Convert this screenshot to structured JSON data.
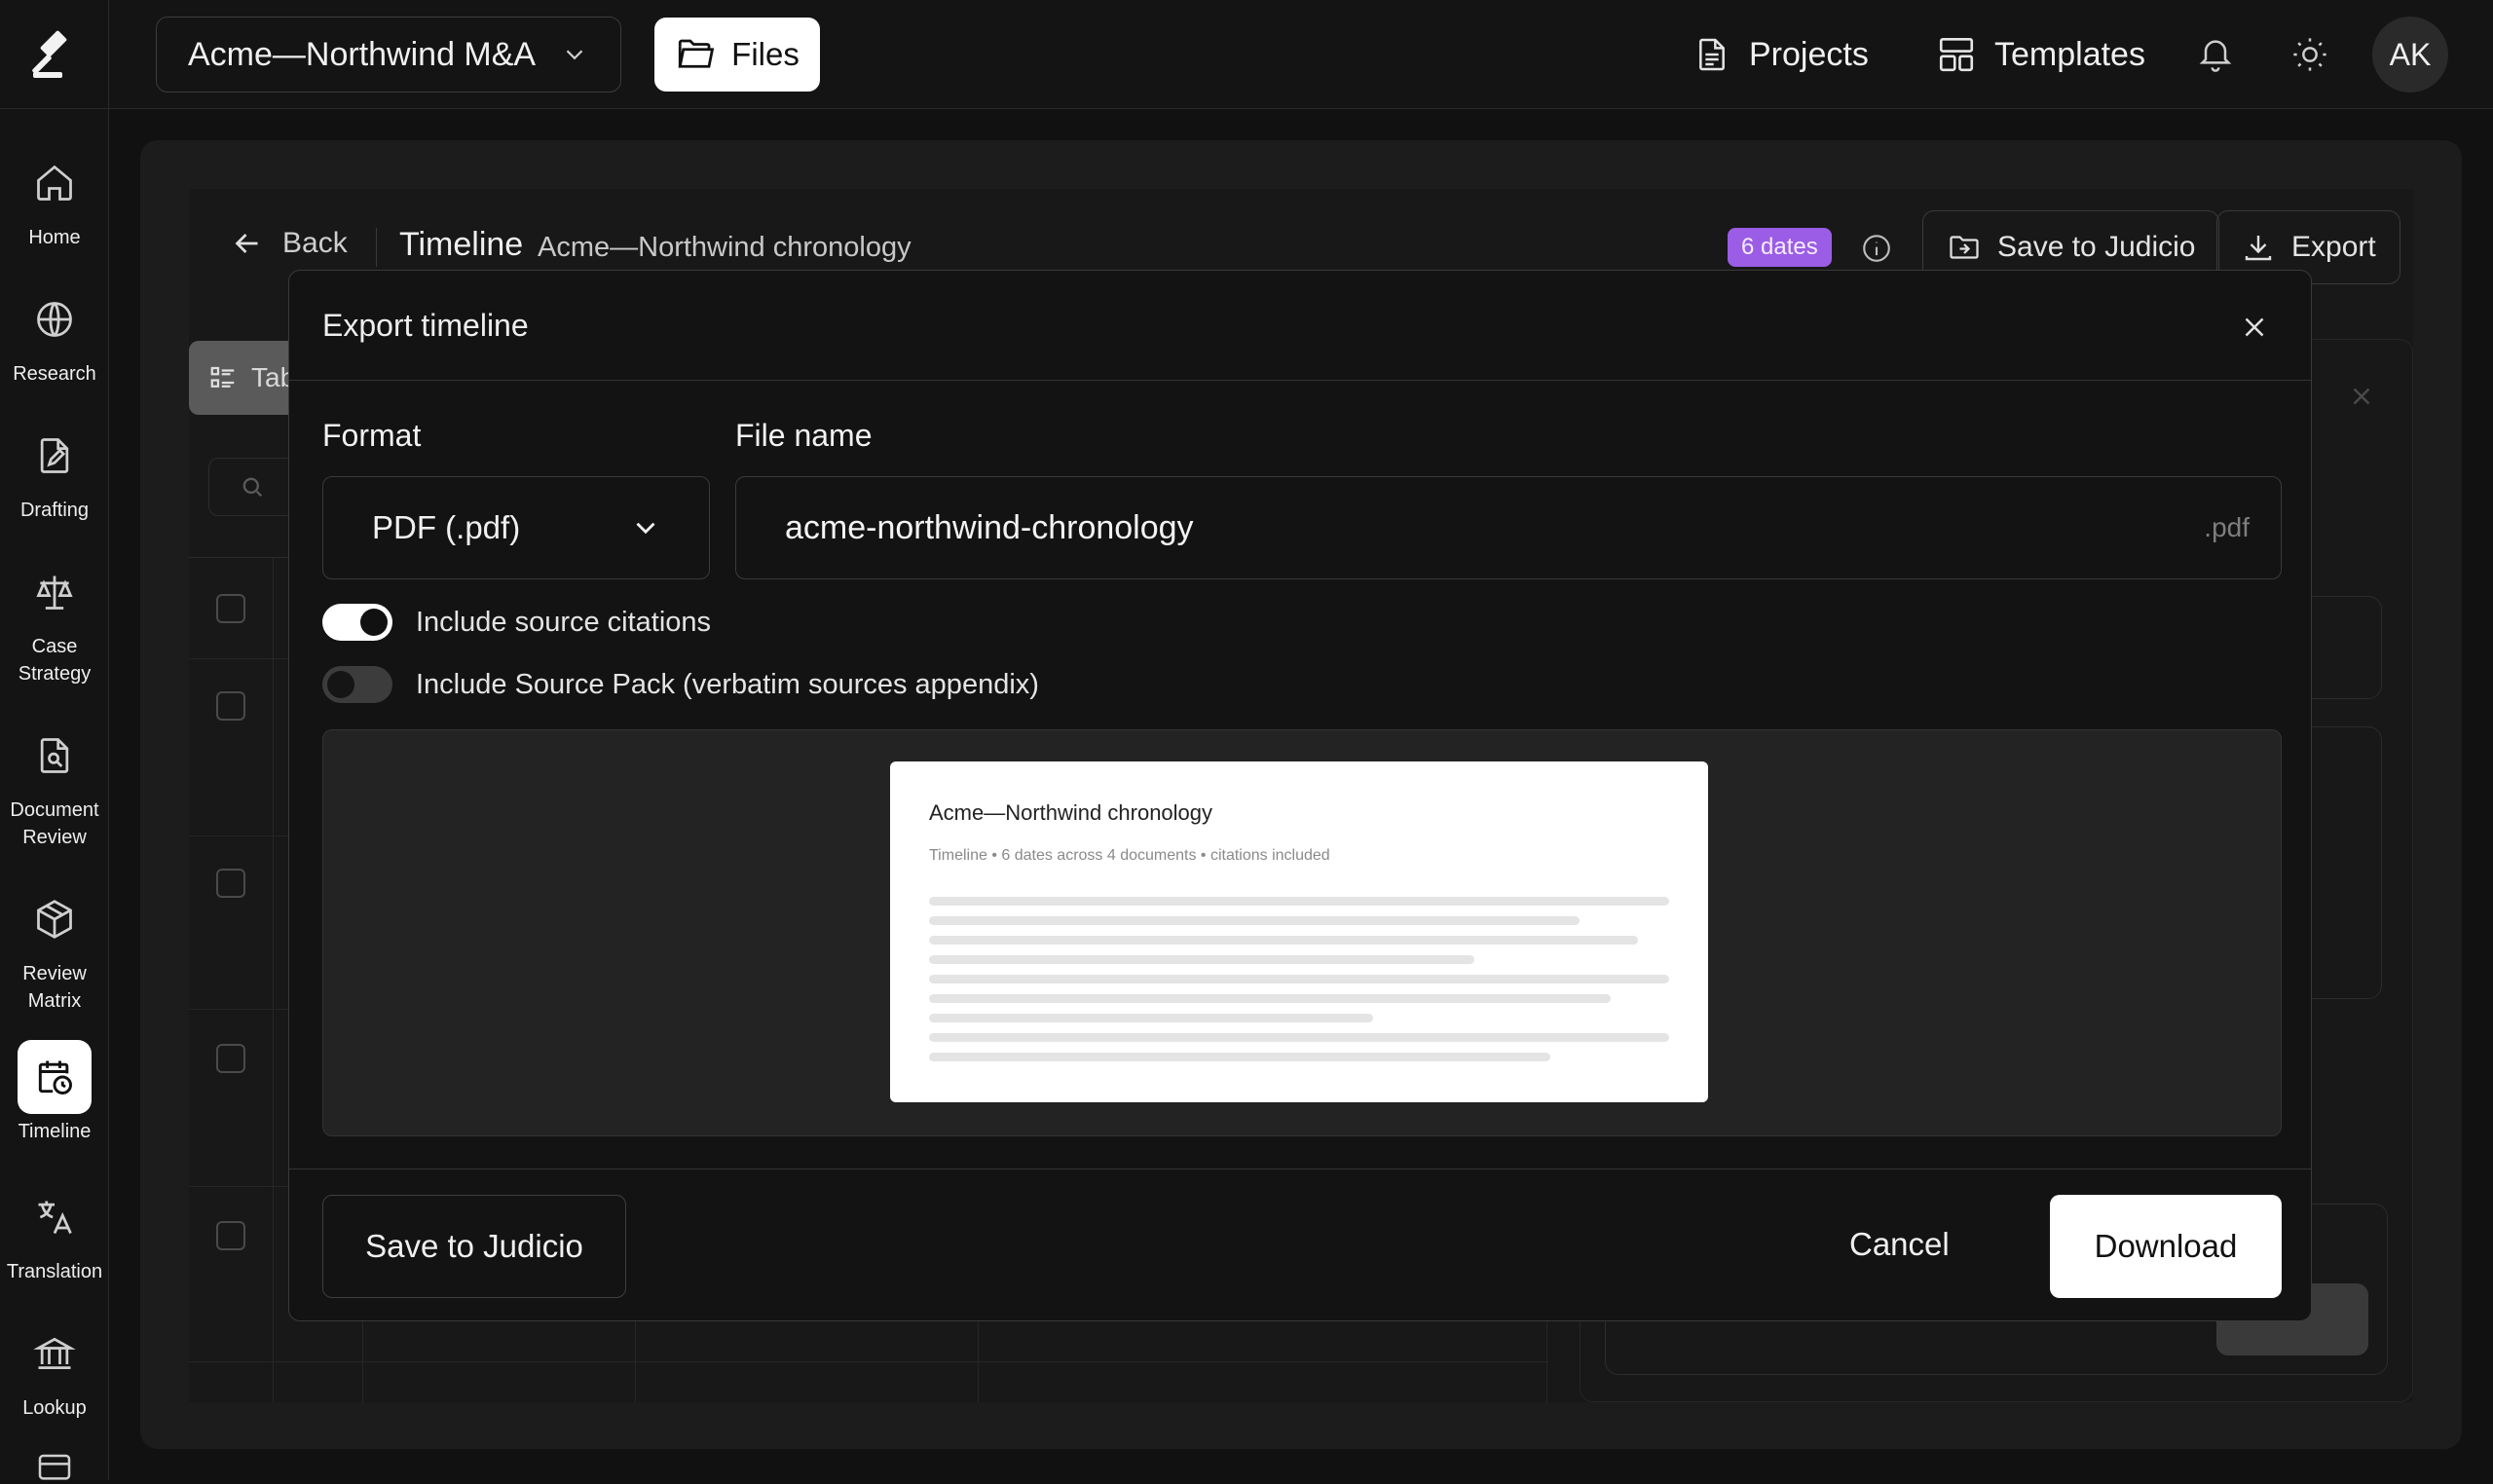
{
  "sidebar": {
    "items": [
      {
        "label": "Home",
        "icon": "home-icon"
      },
      {
        "label": "Research",
        "icon": "globe-icon"
      },
      {
        "label": "Drafting",
        "icon": "pen-file-icon"
      },
      {
        "label": "Case Strategy",
        "icon": "scales-icon"
      },
      {
        "label": "Document Review",
        "icon": "file-search-icon"
      },
      {
        "label": "Review Matrix",
        "icon": "cube-icon"
      },
      {
        "label": "Timeline",
        "icon": "calendar-clock-icon",
        "active": true
      },
      {
        "label": "Translation",
        "icon": "translate-icon"
      },
      {
        "label": "Lookup",
        "icon": "bank-icon"
      }
    ]
  },
  "topbar": {
    "project": "Acme—Northwind M&A",
    "files_label": "Files",
    "projects_label": "Projects",
    "templates_label": "Templates",
    "avatar_initials": "AK"
  },
  "header": {
    "back_label": "Back",
    "title": "Timeline",
    "subtitle": "Acme—Northwind chronology",
    "dates_badge": "6 dates",
    "save_label": "Save to Judicio",
    "export_label": "Export"
  },
  "background": {
    "tab_label": "Tab"
  },
  "modal": {
    "title": "Export timeline",
    "format_label": "Format",
    "format_value": "PDF (.pdf)",
    "filename_label": "File name",
    "filename_value": "acme-northwind-chronology",
    "filename_ext": ".pdf",
    "toggle_citations": {
      "label": "Include source citations",
      "on": true
    },
    "toggle_sourcepack": {
      "label": "Include Source Pack (verbatim sources appendix)",
      "on": false
    },
    "preview": {
      "title": "Acme—Northwind chronology",
      "meta": "Timeline • 6 dates across 4 documents • citations included"
    },
    "save_label": "Save to Judicio",
    "cancel_label": "Cancel",
    "download_label": "Download"
  },
  "colors": {
    "accent_badge": "#9b5de5",
    "background": "#111111",
    "primary_button": "#ffffff"
  }
}
